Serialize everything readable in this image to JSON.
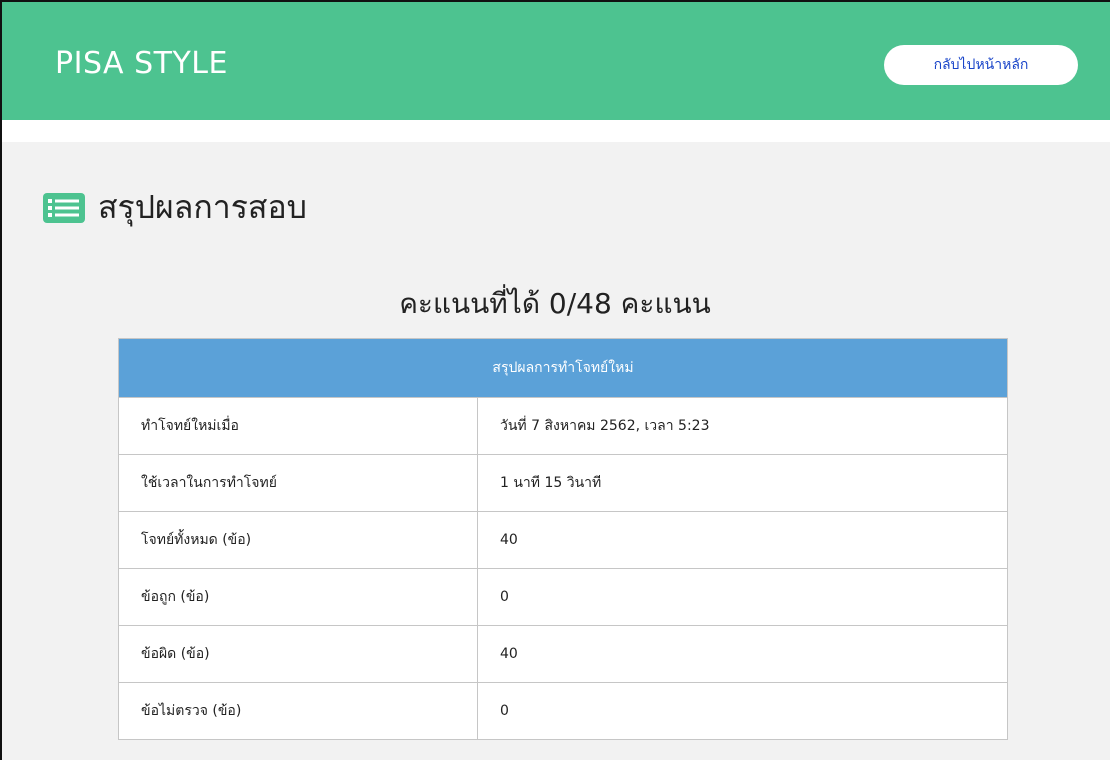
{
  "header": {
    "brand": "PISA STYLE",
    "home_button_label": "กลับไปหน้าหลัก",
    "color": "#4dc390"
  },
  "page": {
    "title": "สรุปผลการสอบ",
    "title_icon": "list-icon",
    "score_text": "คะแนนที่ได้ 0/48 คะแนน"
  },
  "summary_table": {
    "heading": "สรุปผลการทำโจทย์ใหม่",
    "heading_color": "#5ba1d8",
    "rows": [
      {
        "label": "ทำโจทย์ใหม่เมื่อ",
        "value": "วันที่ 7 สิงหาคม 2562, เวลา 5:23"
      },
      {
        "label": "ใช้เวลาในการทำโจทย์",
        "value": "1 นาที 15 วินาที"
      },
      {
        "label": "โจทย์ทั้งหมด (ข้อ)",
        "value": "40"
      },
      {
        "label": "ข้อถูก (ข้อ)",
        "value": "0"
      },
      {
        "label": "ข้อผิด (ข้อ)",
        "value": "40"
      },
      {
        "label": "ข้อไม่ตรวจ (ข้อ)",
        "value": "0"
      }
    ]
  }
}
